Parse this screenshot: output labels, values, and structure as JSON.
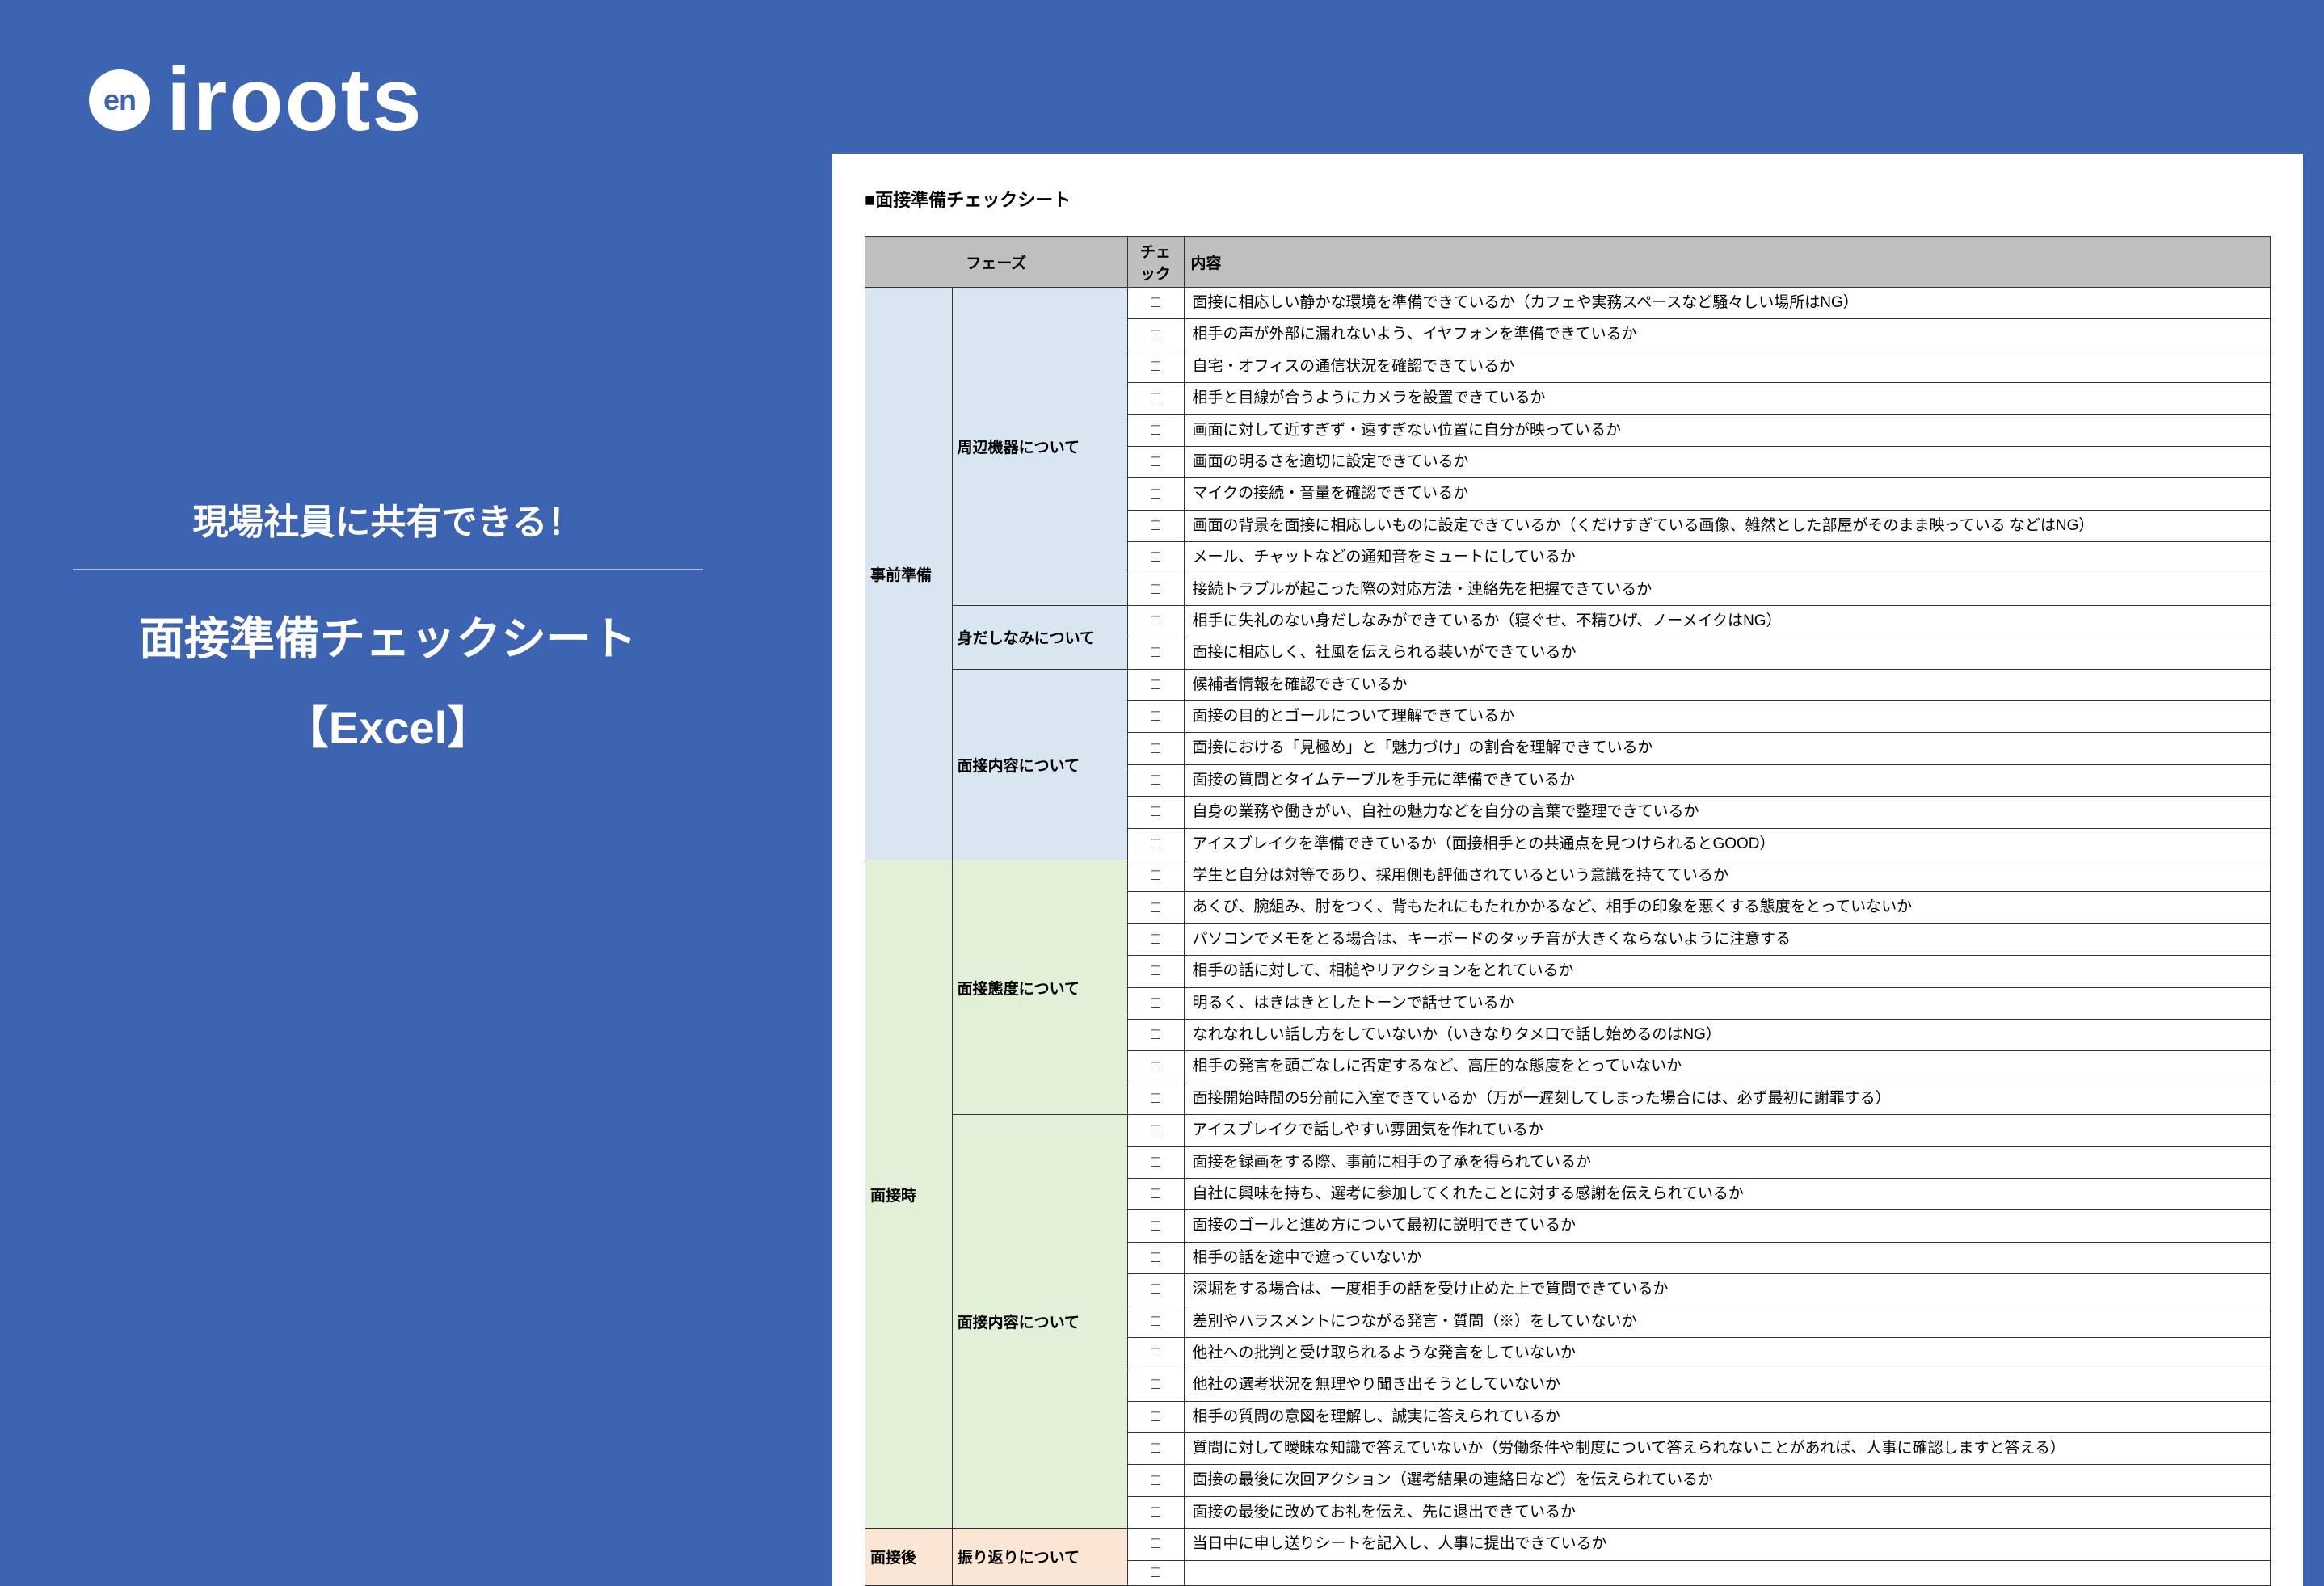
{
  "logo": {
    "badge": "en",
    "brand": "iroots"
  },
  "tagline": {
    "top": "現場社員に共有できる！",
    "title": "面接準備チェックシート",
    "sub": "【Excel】"
  },
  "doc": {
    "title": "■面接準備チェックシート",
    "headers": {
      "phase": "フェーズ",
      "check": "チェック",
      "content": "内容"
    },
    "checkbox": "□",
    "phases": [
      {
        "name": "事前準備",
        "bg": "bg-blue",
        "groups": [
          {
            "sub": "周辺機器について",
            "items": [
              "面接に相応しい静かな環境を準備できているか（カフェや実務スペースなど騒々しい場所はNG）",
              "相手の声が外部に漏れないよう、イヤフォンを準備できているか",
              "自宅・オフィスの通信状況を確認できているか",
              "相手と目線が合うようにカメラを設置できているか",
              "画面に対して近すぎず・遠すぎない位置に自分が映っているか",
              "画面の明るさを適切に設定できているか",
              "マイクの接続・音量を確認できているか",
              "画面の背景を面接に相応しいものに設定できているか（くだけすぎている画像、雑然とした部屋がそのまま映っている などはNG）",
              "メール、チャットなどの通知音をミュートにしているか",
              "接続トラブルが起こった際の対応方法・連絡先を把握できているか"
            ]
          },
          {
            "sub": "身だしなみについて",
            "items": [
              "相手に失礼のない身だしなみができているか（寝ぐせ、不精ひげ、ノーメイクはNG）",
              "面接に相応しく、社風を伝えられる装いができているか"
            ]
          },
          {
            "sub": "面接内容について",
            "items": [
              "候補者情報を確認できているか",
              "面接の目的とゴールについて理解できているか",
              "面接における「見極め」と「魅力づけ」の割合を理解できているか",
              "面接の質問とタイムテーブルを手元に準備できているか",
              "自身の業務や働きがい、自社の魅力などを自分の言葉で整理できているか",
              "アイスブレイクを準備できているか（面接相手との共通点を見つけられるとGOOD）"
            ]
          }
        ]
      },
      {
        "name": "面接時",
        "bg": "bg-green",
        "groups": [
          {
            "sub": "面接態度について",
            "items": [
              "学生と自分は対等であり、採用側も評価されているという意識を持てているか",
              "あくび、腕組み、肘をつく、背もたれにもたれかかるなど、相手の印象を悪くする態度をとっていないか",
              "パソコンでメモをとる場合は、キーボードのタッチ音が大きくならないように注意する",
              "相手の話に対して、相槌やリアクションをとれているか",
              "明るく、はきはきとしたトーンで話せているか",
              "なれなれしい話し方をしていないか（いきなりタメ口で話し始めるのはNG）",
              "相手の発言を頭ごなしに否定するなど、高圧的な態度をとっていないか",
              "面接開始時間の5分前に入室できているか（万が一遅刻してしまった場合には、必ず最初に謝罪する）"
            ]
          },
          {
            "sub": "面接内容について",
            "items": [
              "アイスブレイクで話しやすい雰囲気を作れているか",
              "面接を録画をする際、事前に相手の了承を得られているか",
              "自社に興味を持ち、選考に参加してくれたことに対する感謝を伝えられているか",
              "面接のゴールと進め方について最初に説明できているか",
              "相手の話を途中で遮っていないか",
              "深堀をする場合は、一度相手の話を受け止めた上で質問できているか",
              "差別やハラスメントにつながる発言・質問（※）をしていないか",
              "他社への批判と受け取られるような発言をしていないか",
              "他社の選考状況を無理やり聞き出そうとしていないか",
              "相手の質問の意図を理解し、誠実に答えられているか",
              "質問に対して曖昧な知識で答えていないか（労働条件や制度について答えられないことがあれば、人事に確認しますと答える）",
              "面接の最後に次回アクション（選考結果の連絡日など）を伝えられているか",
              "面接の最後に改めてお礼を伝え、先に退出できているか"
            ]
          }
        ]
      },
      {
        "name": "面接後",
        "bg": "bg-orange",
        "groups": [
          {
            "sub": "振り返りについて",
            "items": [
              "当日中に申し送りシートを記入し、人事に提出できているか",
              ""
            ]
          }
        ]
      }
    ]
  }
}
